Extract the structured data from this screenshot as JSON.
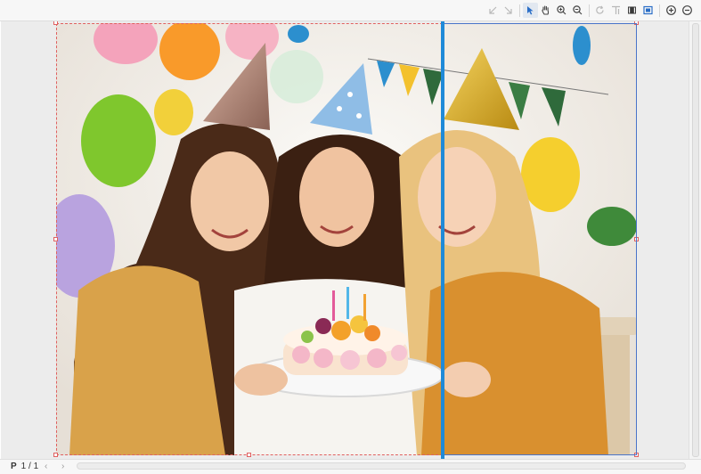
{
  "toolbar": {
    "buttons": [
      {
        "id": "nav-back",
        "icon": "arrow-down-left-icon",
        "enabled": false
      },
      {
        "id": "nav-forward",
        "icon": "arrow-down-right-icon",
        "enabled": false
      },
      {
        "id": "select-tool",
        "icon": "cursor-arrow-icon",
        "active": true
      },
      {
        "id": "pan-tool",
        "icon": "hand-icon"
      },
      {
        "id": "zoom-in-tool",
        "icon": "magnifier-plus-icon"
      },
      {
        "id": "zoom-out-tool",
        "icon": "magnifier-minus-icon"
      },
      {
        "id": "rotate",
        "icon": "rotate-icon",
        "enabled": false
      },
      {
        "id": "text-size",
        "icon": "text-size-icon",
        "enabled": false
      },
      {
        "id": "filmstrip",
        "icon": "filmstrip-icon"
      },
      {
        "id": "fit-screen",
        "icon": "fit-screen-icon"
      },
      {
        "id": "zoom-in",
        "icon": "plus-circle-icon"
      },
      {
        "id": "zoom-out",
        "icon": "minus-circle-icon"
      }
    ]
  },
  "colors": {
    "accent": "#1f8ad8",
    "selection_red": "#e06060",
    "selection_blue": "#4a74c9"
  },
  "status": {
    "page_prefix": "P",
    "page_text": "1 / 1",
    "prev_symbol": "‹",
    "next_symbol": "›"
  }
}
